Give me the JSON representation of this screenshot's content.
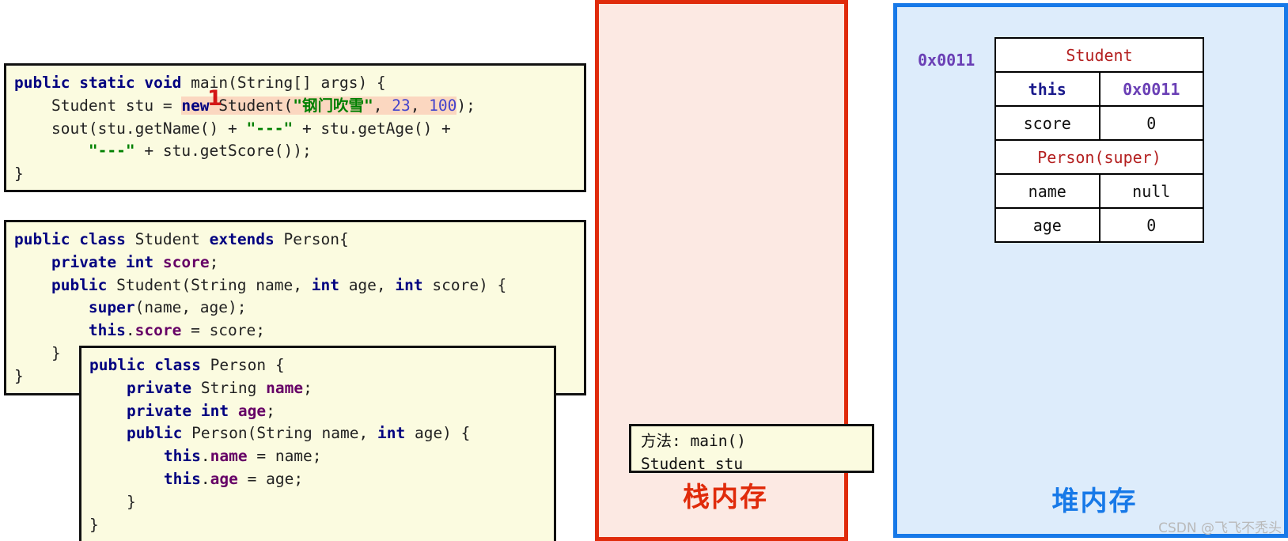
{
  "code_blocks": {
    "main_method": {
      "name": "main-method-code",
      "lines": [
        "public static void main(String[] args) {",
        "    Student stu = new Student(\"钢门吹雪\", 23, 100);",
        "    sout(stu.getName() + \"---\" + stu.getAge() +",
        "        \"---\" + stu.getScore());",
        "}"
      ]
    },
    "student_class": {
      "name": "student-class-code",
      "lines": [
        "public class Student extends Person{",
        "    private int score;",
        "    public Student(String name, int age, int score) {",
        "        super(name, age);",
        "        this.score = score;",
        "    }",
        "}"
      ]
    },
    "person_class": {
      "name": "person-class-code",
      "lines": [
        "public class Person {",
        "    private String name;",
        "    private int age;",
        "    public Person(String name, int age) {",
        "        this.name = name;",
        "        this.age = age;",
        "    }",
        "}"
      ]
    }
  },
  "annotations": {
    "step_marker": "1",
    "highlighted_expression": "new Student(\"钢门吹雪\", 23, 100)"
  },
  "stack": {
    "label": "栈内存",
    "accent_color": "#e02b0b",
    "background_color": "#fce9e3",
    "frame": {
      "method_line": "方法: main()",
      "variable_line": "Student stu"
    }
  },
  "heap": {
    "label": "堆内存",
    "accent_color": "#1779e8",
    "background_color": "#ddecfb",
    "address": "0x0011",
    "object_table": {
      "title": "Student",
      "super_title": "Person(super)",
      "student_fields": [
        {
          "key": "this",
          "value": "0x0011"
        },
        {
          "key": "score",
          "value": "0"
        }
      ],
      "person_fields": [
        {
          "key": "name",
          "value": "null"
        },
        {
          "key": "age",
          "value": "0"
        }
      ]
    }
  },
  "watermark": {
    "text": "CSDN @飞飞不秃头"
  }
}
